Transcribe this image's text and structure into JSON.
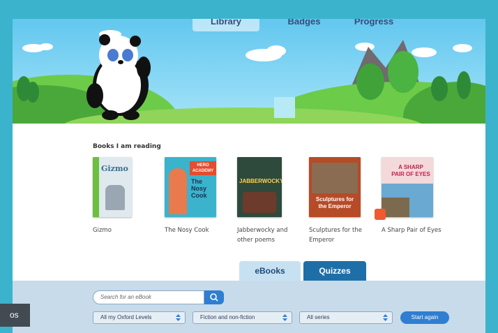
{
  "nav": {
    "tabs": [
      {
        "label": "Library",
        "active": true
      },
      {
        "label": "Badges",
        "active": false
      },
      {
        "label": "Progress",
        "active": false
      }
    ]
  },
  "reading": {
    "title": "Books I am reading",
    "books": [
      {
        "title": "Gizmo",
        "cover_text": "Gizmo",
        "cover_color": "#dfe9ee"
      },
      {
        "title": "The Nosy Cook",
        "cover_text": "The Nosy Cook",
        "cover_badge": "HERO ACADEMY",
        "cover_color": "#3bb3cc"
      },
      {
        "title": "Jabberwocky and other poems",
        "cover_text": "JABBERWOCKY",
        "cover_color": "#2e4a3d"
      },
      {
        "title": "Sculptures for the Emperor",
        "cover_text": "Sculptures for the Emperor",
        "cover_color": "#b64b27"
      },
      {
        "title": "A Sharp Pair of Eyes",
        "cover_text": "A SHARP PAIR OF EYES",
        "cover_color": "#f3d9d9"
      }
    ]
  },
  "tabs": {
    "ebooks": "eBooks",
    "quizzes": "Quizzes"
  },
  "filters": {
    "search_placeholder": "Search for an eBook",
    "levels": "All my Oxford Levels",
    "genre": "Fiction and non-fiction",
    "series": "All series",
    "start_again": "Start again"
  },
  "overlay": {
    "label": "os"
  },
  "colors": {
    "background": "#3bb3cc",
    "accent": "#2f7ed1",
    "quizzes_tab": "#1e6fa8",
    "ebooks_tab": "#c7e1f2"
  }
}
